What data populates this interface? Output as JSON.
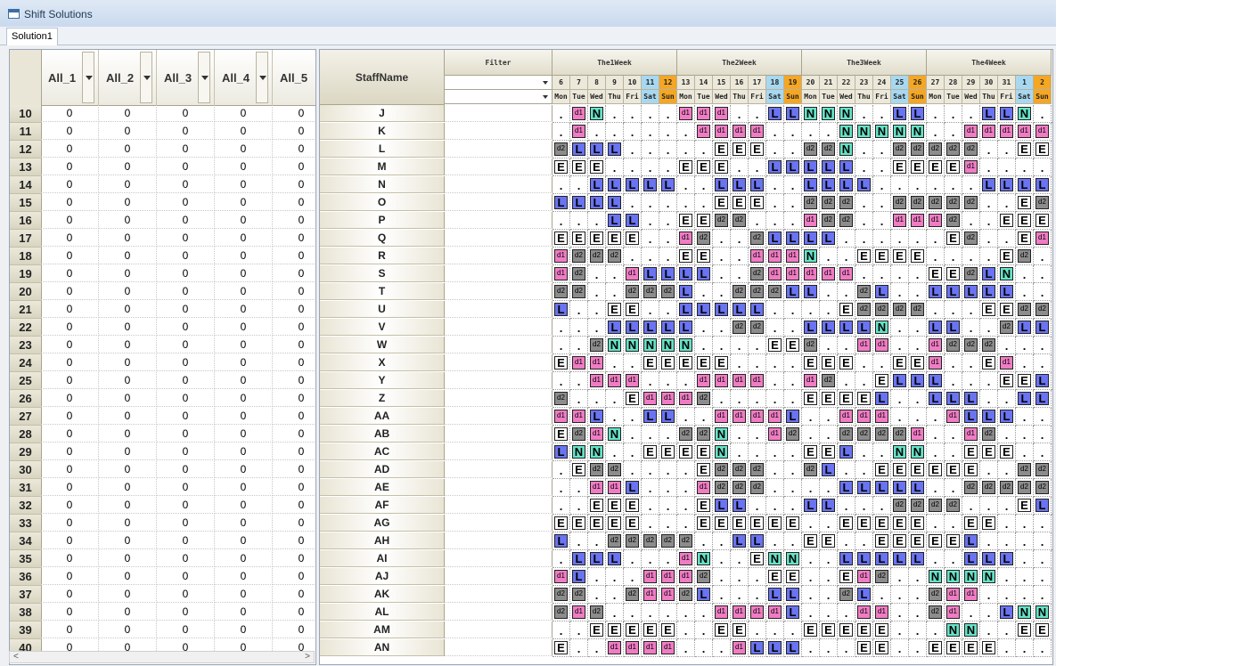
{
  "window": {
    "title": "Shift Solutions",
    "tab": "Solution1"
  },
  "left_columns": [
    "All_1",
    "All_2",
    "All_3",
    "All_4",
    "All_5"
  ],
  "staff_header": "StaffName",
  "filter_header": "Filter",
  "weeks": [
    "The1Week",
    "The2Week",
    "The3Week",
    "The4Week"
  ],
  "days": [
    {
      "n": "6",
      "d": "Mon"
    },
    {
      "n": "7",
      "d": "Tue"
    },
    {
      "n": "8",
      "d": "Wed"
    },
    {
      "n": "9",
      "d": "Thu"
    },
    {
      "n": "10",
      "d": "Fri"
    },
    {
      "n": "11",
      "d": "Sat"
    },
    {
      "n": "12",
      "d": "Sun"
    },
    {
      "n": "13",
      "d": "Mon"
    },
    {
      "n": "14",
      "d": "Tue"
    },
    {
      "n": "15",
      "d": "Wed"
    },
    {
      "n": "16",
      "d": "Thu"
    },
    {
      "n": "17",
      "d": "Fri"
    },
    {
      "n": "18",
      "d": "Sat"
    },
    {
      "n": "19",
      "d": "Sun"
    },
    {
      "n": "20",
      "d": "Mon"
    },
    {
      "n": "21",
      "d": "Tue"
    },
    {
      "n": "22",
      "d": "Wed"
    },
    {
      "n": "23",
      "d": "Thu"
    },
    {
      "n": "24",
      "d": "Fri"
    },
    {
      "n": "25",
      "d": "Sat"
    },
    {
      "n": "26",
      "d": "Sun"
    },
    {
      "n": "27",
      "d": "Mon"
    },
    {
      "n": "28",
      "d": "Tue"
    },
    {
      "n": "29",
      "d": "Wed"
    },
    {
      "n": "30",
      "d": "Thu"
    },
    {
      "n": "31",
      "d": "Fri"
    },
    {
      "n": "1",
      "d": "Sat"
    },
    {
      "n": "2",
      "d": "Sun"
    }
  ],
  "shift_colors": {
    "L": "#6a74f2",
    "N": "#66e3c7",
    "E": "#ffffff",
    "d1": "#f07cc4",
    "d2": "#8c8c8c"
  },
  "rows": [
    {
      "num": "10",
      "name": "J",
      "vals": [
        "0",
        "0",
        "0",
        "0",
        "0"
      ],
      "sched": ". d1 N . . . . d1 d1 d1 . . L L N N N . . L L . . . L L N . ."
    },
    {
      "num": "11",
      "name": "K",
      "vals": [
        "0",
        "0",
        "0",
        "0",
        "0"
      ],
      "sched": ". d1 . . . . . . d1 d1 d1 d1 . . . . N N N N N . . d1 d1 d1 d1 d1"
    },
    {
      "num": "12",
      "name": "L",
      "vals": [
        "0",
        "0",
        "0",
        "0",
        "0"
      ],
      "sched": "d2 L L L . . . . . E E E . . d2 d2 N . . d2 d2 d2 d2 d2 . . E E"
    },
    {
      "num": "13",
      "name": "M",
      "vals": [
        "0",
        "0",
        "0",
        "0",
        "0"
      ],
      "sched": "E E E . . . . E E E . . L L L L L . . E E E E d1 . . . ."
    },
    {
      "num": "14",
      "name": "N",
      "vals": [
        "0",
        "0",
        "0",
        "0",
        "0"
      ],
      "sched": ". . L L L L L . . L L L . . L L L L . . . . . . L L L L"
    },
    {
      "num": "15",
      "name": "O",
      "vals": [
        "0",
        "0",
        "0",
        "0",
        "0"
      ],
      "sched": "L L L L . . . . . E E E . . d2 d2 d2 . . d2 d2 d2 d2 d2 . . E d2"
    },
    {
      "num": "16",
      "name": "P",
      "vals": [
        "0",
        "0",
        "0",
        "0",
        "0"
      ],
      "sched": ". . . L L . . E E d2 d2 . . . d1 d2 d2 . . d1 d1 d1 d2 . . E E E"
    },
    {
      "num": "17",
      "name": "Q",
      "vals": [
        "0",
        "0",
        "0",
        "0",
        "0"
      ],
      "sched": "E E E E E . . d1 d2 . . d2 L L L L . . . . . . E d2 . . E d1"
    },
    {
      "num": "18",
      "name": "R",
      "vals": [
        "0",
        "0",
        "0",
        "0",
        "0"
      ],
      "sched": "d1 d2 d2 d2 . . . E E . . d1 d1 d1 N . . E E E E . . . . E d2 ."
    },
    {
      "num": "19",
      "name": "S",
      "vals": [
        "0",
        "0",
        "0",
        "0",
        "0"
      ],
      "sched": "d1 d2 . . d1 L L L L . . d2 d1 d1 d1 d1 d1 . . . . E E d2 L N . ."
    },
    {
      "num": "20",
      "name": "T",
      "vals": [
        "0",
        "0",
        "0",
        "0",
        "0"
      ],
      "sched": "d2 d2 . . d2 d2 d2 L . . d2 d2 d2 L L . . d2 L . . L L L L L . ."
    },
    {
      "num": "21",
      "name": "U",
      "vals": [
        "0",
        "0",
        "0",
        "0",
        "0"
      ],
      "sched": "L . . E E . . L L L L L . . . . E d2 d2 d2 d2 . . . E E d2 d2"
    },
    {
      "num": "22",
      "name": "V",
      "vals": [
        "0",
        "0",
        "0",
        "0",
        "0"
      ],
      "sched": ". . . L L L L L . . d2 d2 . . L L L L N . . L L . . d2 L L"
    },
    {
      "num": "23",
      "name": "W",
      "vals": [
        "0",
        "0",
        "0",
        "0",
        "0"
      ],
      "sched": ". . d2 N N N N N . . . . E E d2 . . d1 d1 . . d1 d2 d2 d2 . . ."
    },
    {
      "num": "24",
      "name": "X",
      "vals": [
        "0",
        "0",
        "0",
        "0",
        "0"
      ],
      "sched": "E d1 d1 . . E E E E E . . . . E E E . . E E d1 . . E d1 . ."
    },
    {
      "num": "25",
      "name": "Y",
      "vals": [
        "0",
        "0",
        "0",
        "0",
        "0"
      ],
      "sched": ". . d1 d1 d1 . . . d1 d1 d1 d1 . . d1 d2 . . E L L L . . . E E L L"
    },
    {
      "num": "26",
      "name": "Z",
      "vals": [
        "0",
        "0",
        "0",
        "0",
        "0"
      ],
      "sched": "d2 . . . E d1 d1 d1 d2 . . . . . E E E E L . . L L L . . L L"
    },
    {
      "num": "27",
      "name": "AA",
      "vals": [
        "0",
        "0",
        "0",
        "0",
        "0"
      ],
      "sched": "d1 d1 L . . L L . . d1 d1 d1 d1 L . . d1 d1 d1 . . . d1 L L L . ."
    },
    {
      "num": "28",
      "name": "AB",
      "vals": [
        "0",
        "0",
        "0",
        "0",
        "0"
      ],
      "sched": "E d2 d1 N . . . d2 d2 N . . d1 d2 . . d2 d2 d2 d2 d1 . . d1 d2 . . ."
    },
    {
      "num": "29",
      "name": "AC",
      "vals": [
        "0",
        "0",
        "0",
        "0",
        "0"
      ],
      "sched": "L N N . . E E E E N . . . . E E L . . N N . . E E E . ."
    },
    {
      "num": "30",
      "name": "AD",
      "vals": [
        "0",
        "0",
        "0",
        "0",
        "0"
      ],
      "sched": ". E d2 d2 . . . . E d2 d2 d2 . . d2 L . . E E E E E E . . d2 d2"
    },
    {
      "num": "31",
      "name": "AE",
      "vals": [
        "0",
        "0",
        "0",
        "0",
        "0"
      ],
      "sched": ". . d1 d1 L . . . d1 d2 d2 d2 . . . . L L L L L . . d2 d2 d2 d2 d2"
    },
    {
      "num": "32",
      "name": "AF",
      "vals": [
        "0",
        "0",
        "0",
        "0",
        "0"
      ],
      "sched": ". . E E E . . . E L L . . . L L . . . d2 d2 d2 d2 . . . E L L"
    },
    {
      "num": "33",
      "name": "AG",
      "vals": [
        "0",
        "0",
        "0",
        "0",
        "0"
      ],
      "sched": "E E E E E . . . E E E E E E . . E E E E E . . E E . . ."
    },
    {
      "num": "34",
      "name": "AH",
      "vals": [
        "0",
        "0",
        "0",
        "0",
        "0"
      ],
      "sched": "L . . d2 d2 d2 d2 d2 . . L L . . E E . . E E E E E L . . . . ."
    },
    {
      "num": "35",
      "name": "AI",
      "vals": [
        "0",
        "0",
        "0",
        "0",
        "0"
      ],
      "sched": ". L L L . . . d1 N . . E N N . . L L L L L . . L L L . ."
    },
    {
      "num": "36",
      "name": "AJ",
      "vals": [
        "0",
        "0",
        "0",
        "0",
        "0"
      ],
      "sched": "d1 L . . . d1 d1 d1 d2 . . . E E . . E d1 d2 . . N N N N . . ."
    },
    {
      "num": "37",
      "name": "AK",
      "vals": [
        "0",
        "0",
        "0",
        "0",
        "0"
      ],
      "sched": "d2 d2 . . d2 d1 d1 d2 L . . . L L . . d2 L . . . d2 d1 d1 . . . ."
    },
    {
      "num": "38",
      "name": "AL",
      "vals": [
        "0",
        "0",
        "0",
        "0",
        "0"
      ],
      "sched": "d2 d1 d2 . . . . . . d1 d1 d1 d1 L . . . d1 d1 . . d2 d1 . . L N N"
    },
    {
      "num": "39",
      "name": "AM",
      "vals": [
        "0",
        "0",
        "0",
        "0",
        "0"
      ],
      "sched": ". . E E E E E . . E E . . . E E E E E . . . N N . . E E"
    },
    {
      "num": "40",
      "name": "AN",
      "vals": [
        "0",
        "0",
        "0",
        "0",
        "0"
      ],
      "sched": "E . . d1 d1 d1 d1 . . . d1 L L L . . . E E . . E E E E . . ."
    }
  ]
}
